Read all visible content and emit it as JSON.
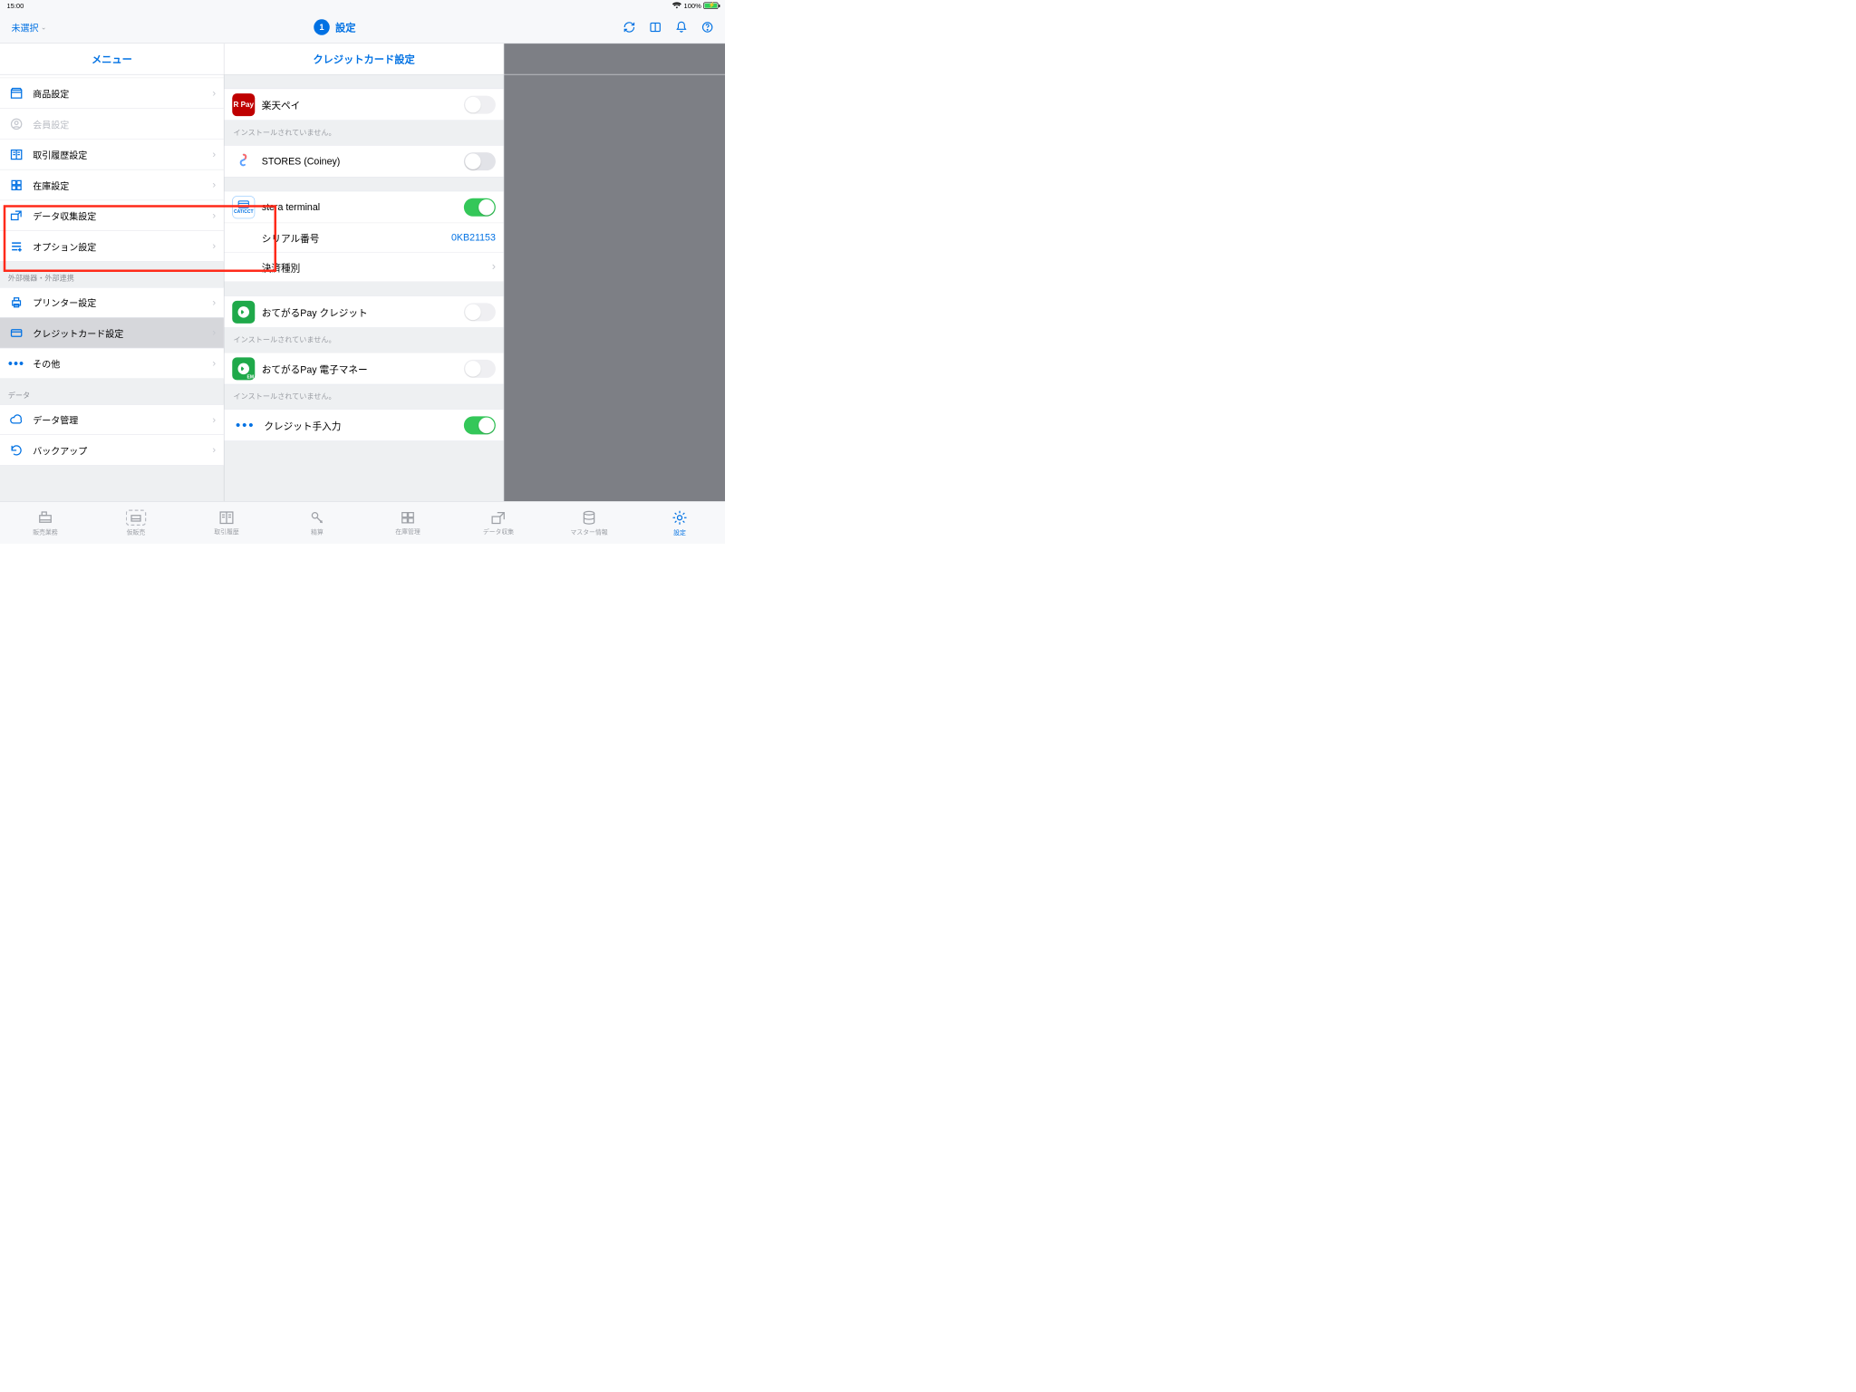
{
  "status": {
    "time": "15:00",
    "battery": "100%"
  },
  "nav": {
    "dropdown": "未選択",
    "badge": "1",
    "title": "設定"
  },
  "columns": {
    "left": "メニュー",
    "mid": "クレジットカード設定"
  },
  "menu": {
    "items": [
      {
        "label": "商品設定"
      },
      {
        "label": "会員設定",
        "disabled": true
      },
      {
        "label": "取引履歴設定"
      },
      {
        "label": "在庫設定"
      },
      {
        "label": "データ収集設定"
      },
      {
        "label": "オプション設定"
      }
    ],
    "group2_label": "外部機器・外部連携",
    "group2": [
      {
        "label": "プリンター設定"
      },
      {
        "label": "クレジットカード設定",
        "selected": true
      },
      {
        "label": "その他"
      }
    ],
    "group3_label": "データ",
    "group3": [
      {
        "label": "データ管理"
      },
      {
        "label": "バックアップ"
      }
    ]
  },
  "detail": {
    "rakuten": {
      "label": "楽天ペイ",
      "note": "インストールされていません。",
      "on": false
    },
    "coiney": {
      "label": "STORES (Coiney)",
      "on": false
    },
    "stera": {
      "label": "stera terminal",
      "on": true,
      "serial_label": "シリアル番号",
      "serial_value": "0KB21153",
      "type_label": "決済種別"
    },
    "otegaru_credit": {
      "label": "おてがるPay クレジット",
      "note": "インストールされていません。",
      "on": false
    },
    "otegaru_em": {
      "label": "おてがるPay 電子マネー",
      "note": "インストールされていません。",
      "on": false
    },
    "manual": {
      "label": "クレジット手入力",
      "on": true
    }
  },
  "tabs": [
    {
      "label": "販売業務"
    },
    {
      "label": "仮販売"
    },
    {
      "label": "取引履歴"
    },
    {
      "label": "精算"
    },
    {
      "label": "在庫管理"
    },
    {
      "label": "データ収集"
    },
    {
      "label": "マスター情報"
    },
    {
      "label": "設定",
      "active": true
    }
  ]
}
